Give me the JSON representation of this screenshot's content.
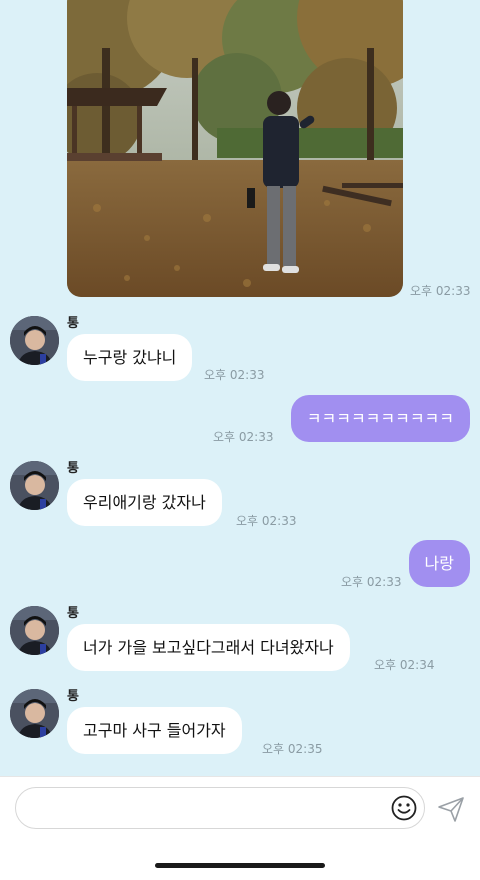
{
  "conversation": {
    "photo_time": "오후 02:33",
    "messages": [
      {
        "side": "in",
        "sender": "통",
        "text": "누구랑 갔냐니",
        "time": "오후 02:33"
      },
      {
        "side": "out",
        "text": "ㅋㅋㅋㅋㅋㅋㅋㅋㅋㅋ",
        "time": "오후 02:33"
      },
      {
        "side": "in",
        "sender": "통",
        "text": "우리애기랑 갔자나",
        "time": "오후 02:33"
      },
      {
        "side": "out",
        "text": "나랑",
        "time": "오후 02:33"
      },
      {
        "side": "in",
        "sender": "통",
        "text": "너가 가을 보고싶다그래서 다녀왔자나",
        "time": "오후 02:34"
      },
      {
        "side": "in",
        "sender": "통",
        "text": "고구마 사구 들어가자",
        "time": "오후 02:35"
      }
    ]
  },
  "input": {
    "value": "",
    "placeholder": ""
  },
  "icons": {
    "emoji": "smiley-icon",
    "send": "paper-plane-icon"
  },
  "colors": {
    "background": "#dcf1f8",
    "outgoing_bubble": "#a18ff0",
    "incoming_bubble": "#ffffff"
  }
}
